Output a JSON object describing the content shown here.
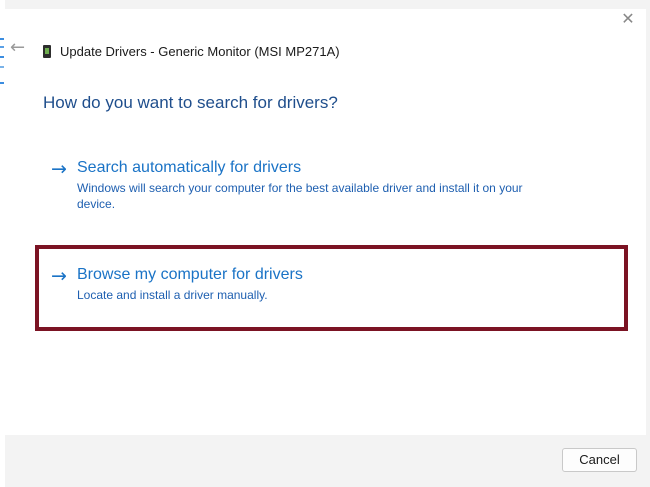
{
  "window": {
    "title": "Update Drivers - Generic Monitor (MSI MP271A)",
    "close_icon": "close-icon",
    "back_icon": "back-arrow-icon"
  },
  "main": {
    "question": "How do you want to search for drivers?",
    "options": [
      {
        "icon": "arrow-right-icon",
        "title": "Search automatically for drivers",
        "description": "Windows will search your computer for the best available driver and install it on your device.",
        "highlighted": false
      },
      {
        "icon": "arrow-right-icon",
        "title": "Browse my computer for drivers",
        "description": "Locate and install a driver manually.",
        "highlighted": true
      }
    ]
  },
  "footer": {
    "cancel_label": "Cancel"
  },
  "colors": {
    "link_blue": "#1a73c6",
    "heading_blue": "#1f4e8c",
    "highlight_border": "#7b1323",
    "footer_bg": "#f3f3f3"
  }
}
